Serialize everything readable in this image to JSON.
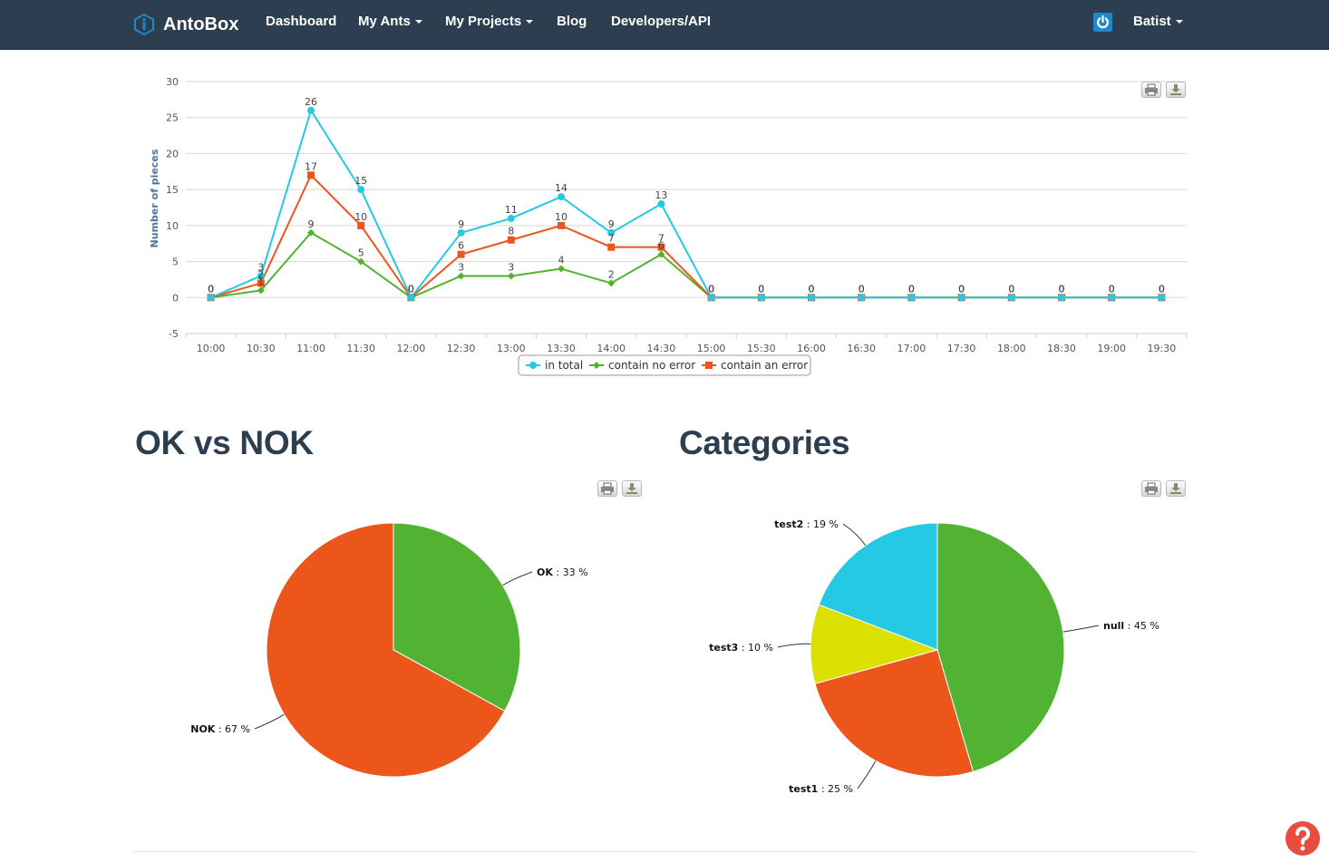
{
  "nav": {
    "brand": "AntoBox",
    "items": [
      {
        "label": "Dashboard",
        "dropdown": false
      },
      {
        "label": "My Ants",
        "dropdown": true
      },
      {
        "label": "My Projects",
        "dropdown": true
      },
      {
        "label": "Blog",
        "dropdown": false
      },
      {
        "label": "Developers/API",
        "dropdown": false
      }
    ],
    "user": "Batist"
  },
  "sections": {
    "ok_vs_nok": "OK vs NOK",
    "categories": "Categories"
  },
  "colors": {
    "navbar": "#2c3e50",
    "in_total": "#26c9e4",
    "no_error": "#52b332",
    "with_error": "#ec561b",
    "test3": "#dbe000",
    "help": "#e74c3c"
  },
  "icons": {
    "brand": "info-badge-icon",
    "power": "power-icon",
    "print": "print-icon",
    "download": "download-icon",
    "help": "question-mark-icon"
  },
  "chart_data": [
    {
      "type": "line",
      "title": "",
      "xlabel": "",
      "ylabel": "Number of pieces",
      "ylim": [
        -5,
        30
      ],
      "yticks": [
        -5,
        0,
        5,
        10,
        15,
        20,
        25,
        30
      ],
      "grid": true,
      "legend_position": "bottom",
      "x": [
        "10:00",
        "10:30",
        "11:00",
        "11:30",
        "12:00",
        "12:30",
        "13:00",
        "13:30",
        "14:00",
        "14:30",
        "15:00",
        "15:30",
        "16:00",
        "16:30",
        "17:00",
        "17:30",
        "18:00",
        "18:30",
        "19:00",
        "19:30"
      ],
      "series": [
        {
          "name": "in total",
          "color": "#26c9e4",
          "marker": "circle",
          "values": [
            0,
            3,
            26,
            15,
            0,
            9,
            11,
            14,
            9,
            13,
            0,
            0,
            0,
            0,
            0,
            0,
            0,
            0,
            0,
            0
          ]
        },
        {
          "name": "contain no error",
          "color": "#52b332",
          "marker": "diamond",
          "values": [
            0,
            1,
            9,
            5,
            0,
            3,
            3,
            4,
            2,
            6,
            0,
            0,
            0,
            0,
            0,
            0,
            0,
            0,
            0,
            0
          ]
        },
        {
          "name": "contain an error",
          "color": "#ec561b",
          "marker": "square",
          "values": [
            0,
            2,
            17,
            10,
            0,
            6,
            8,
            10,
            7,
            7,
            0,
            0,
            0,
            0,
            0,
            0,
            0,
            0,
            0,
            0
          ]
        }
      ],
      "labeled_series": [
        "in total",
        "contain no error",
        "contain an error"
      ]
    },
    {
      "type": "pie",
      "title": "OK vs NOK",
      "slices": [
        {
          "name": "OK",
          "value": 33,
          "label": ": 33 %",
          "color": "#52b332"
        },
        {
          "name": "NOK",
          "value": 67,
          "label": ": 67 %",
          "color": "#ec561b"
        }
      ]
    },
    {
      "type": "pie",
      "title": "Categories",
      "slices": [
        {
          "name": "null",
          "value": 45,
          "label": ": 45 %",
          "color": "#52b332"
        },
        {
          "name": "test1",
          "value": 25,
          "label": ": 25 %",
          "color": "#ec561b"
        },
        {
          "name": "test3",
          "value": 10,
          "label": ": 10 %",
          "color": "#dbe000"
        },
        {
          "name": "test2",
          "value": 19,
          "label": ": 19 %",
          "color": "#26c9e4"
        }
      ]
    }
  ]
}
